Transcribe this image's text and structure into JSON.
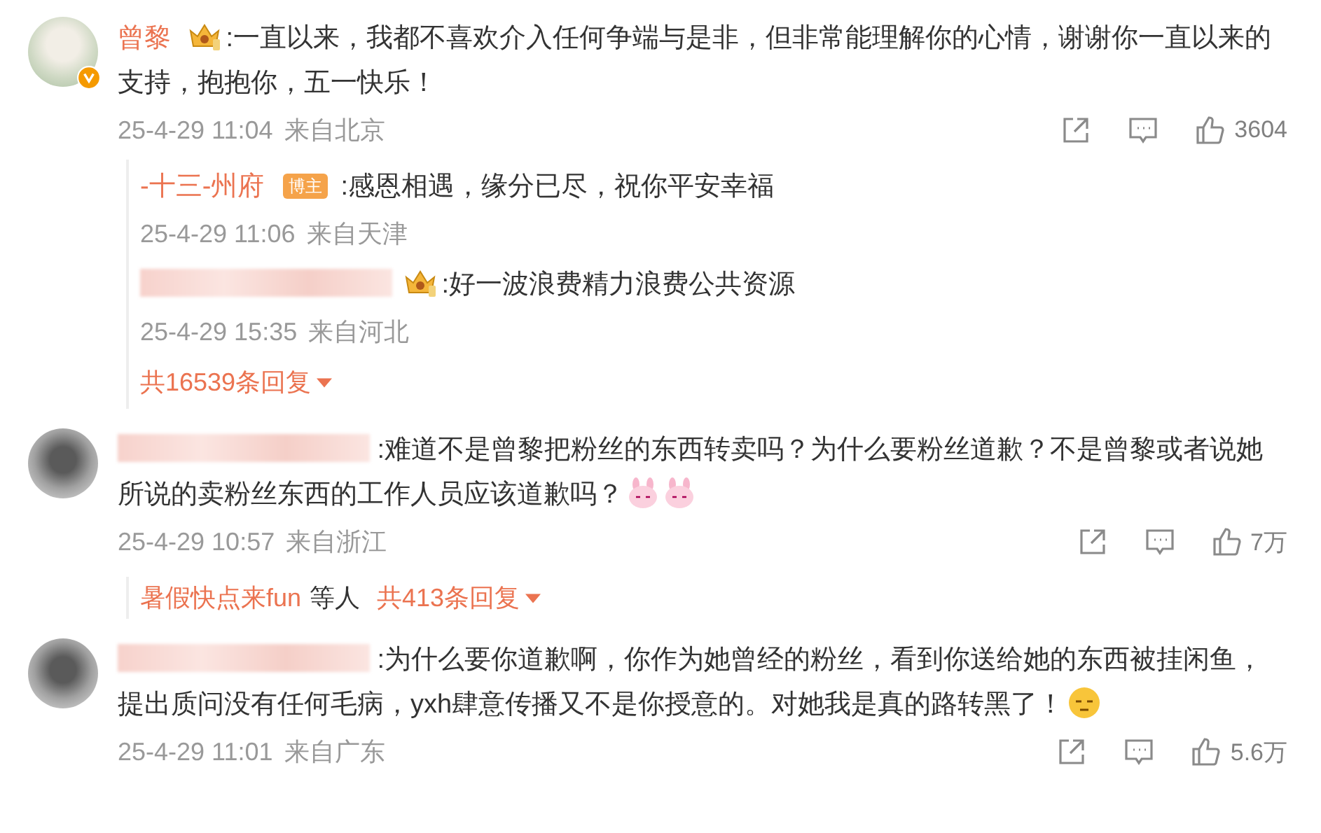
{
  "comments": [
    {
      "author": {
        "kind": "name",
        "name": "曾黎",
        "badge": {
          "kind": "crown"
        }
      },
      "avatar": {
        "kind": "photo",
        "verified": true
      },
      "text": ":一直以来，我都不喜欢介入任何争端与是非，但非常能理解你的心情，谢谢你一直以来的支持，抱抱你，五一快乐！",
      "time": "25-4-29 11:04",
      "source": "来自北京",
      "likes": "3604",
      "replies": [
        {
          "author": {
            "kind": "name",
            "name": "-十三-州府",
            "tag": "博主"
          },
          "text": ":感恩相遇，缘分已尽，祝你平安幸福",
          "time": "25-4-29 11:06",
          "source": "来自天津"
        },
        {
          "author": {
            "kind": "blurred",
            "badge": {
              "kind": "crown"
            }
          },
          "text": ":好一波浪费精力浪费公共资源",
          "time": "25-4-29 15:35",
          "source": "来自河北"
        }
      ],
      "more": {
        "count": "共16539条回复"
      }
    },
    {
      "author": {
        "kind": "blurred"
      },
      "avatar": {
        "kind": "blurred"
      },
      "text": ":难道不是曾黎把粉丝的东西转卖吗？为什么要粉丝道歉？不是曾黎或者说她所说的卖粉丝东西的工作人员应该道歉吗？",
      "emoji": [
        {
          "kind": "bunny"
        },
        {
          "kind": "bunny"
        }
      ],
      "time": "25-4-29 10:57",
      "source": "来自浙江",
      "likes": "7万",
      "summary": {
        "name": "暑假快点来fun",
        "suffix": "等人",
        "count": "共413条回复"
      }
    },
    {
      "author": {
        "kind": "blurred"
      },
      "avatar": {
        "kind": "blurred"
      },
      "text": ":为什么要你道歉啊，你作为她曾经的粉丝，看到你送给她的东西被挂闲鱼，提出质问没有任何毛病，yxh肆意传播又不是你授意的。对她我是真的路转黑了！",
      "emoji": [
        {
          "kind": "sleepy"
        }
      ],
      "time": "25-4-29 11:01",
      "source": "来自广东",
      "likes": "5.6万"
    }
  ]
}
